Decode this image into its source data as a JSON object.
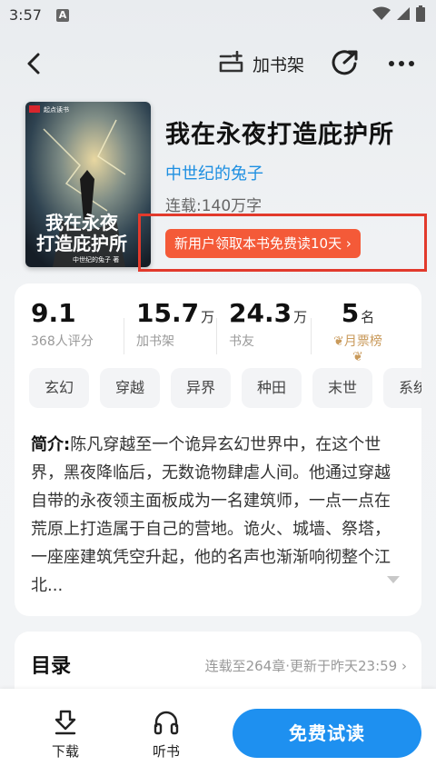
{
  "statusbar": {
    "time": "3:57",
    "notif_letter": "A"
  },
  "navbar": {
    "shelf_label": "加书架"
  },
  "book": {
    "cover_publisher": "起点读书",
    "cover_title_line1": "我在永夜",
    "cover_title_line2": "打造庇护所",
    "cover_author": "中世纪的兔子 著",
    "title": "我在永夜打造庇护所",
    "author": "中世纪的兔子",
    "status": "连载:140万字",
    "promo": "新用户领取本书免费读10天 ›"
  },
  "stats": {
    "rating": {
      "value": "9.1",
      "sub": "368人评分"
    },
    "shelf": {
      "value": "15.7",
      "unit": "万",
      "sub": "加书架"
    },
    "fans": {
      "value": "24.3",
      "unit": "万",
      "sub": "书友"
    },
    "rank": {
      "value": "5",
      "unit": "名",
      "sub": "月票榜"
    }
  },
  "tags": [
    "玄幻",
    "穿越",
    "异界",
    "种田",
    "末世",
    "系统"
  ],
  "intro": {
    "label": "简介:",
    "text": "陈凡穿越至一个诡异玄幻世界中，在这个世界，黑夜降临后，无数诡物肆虐人间。他通过穿越自带的永夜领主面板成为一名建筑师，一点一点在荒原上打造属于自己的营地。诡火、城墙、祭塔，一座座建筑凭空升起，他的名声也渐渐响彻整个江北..."
  },
  "toc": {
    "title": "目录",
    "info": "连载至264章·更新于昨天23:59 ›"
  },
  "bottombar": {
    "download_label": "下载",
    "listen_label": "听书",
    "read_label": "免费试读"
  },
  "colors": {
    "accent_blue": "#1e90f0",
    "promo_red": "#f45a38",
    "outline_red": "#e23a2c",
    "author_blue": "#1e8fe1"
  }
}
